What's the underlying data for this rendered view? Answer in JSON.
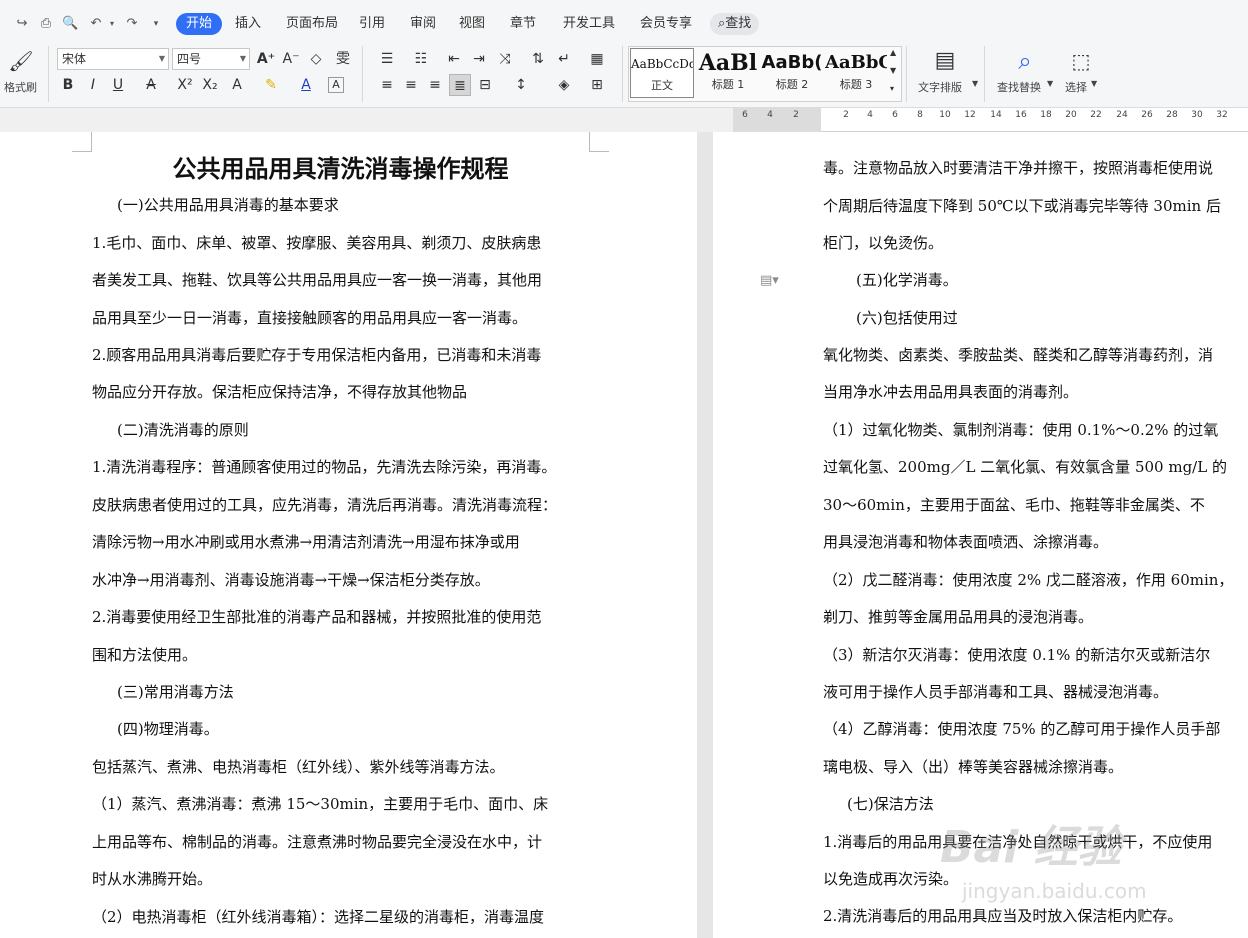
{
  "menubar": {
    "tabs": [
      "开始",
      "插入",
      "页面布局",
      "引用",
      "审阅",
      "视图",
      "章节",
      "开发工具",
      "会员专享"
    ],
    "active_tab": "开始",
    "search_label": "查找"
  },
  "ribbon": {
    "format_painter_label": "格式刷",
    "font_name": "宋体",
    "font_size": "四号",
    "styles": [
      {
        "sample": "AaBbCcDd",
        "name": "正文"
      },
      {
        "sample": "AaBl",
        "name": "标题 1"
      },
      {
        "sample": "AaBb(",
        "name": "标题 2"
      },
      {
        "sample": "AaBbC",
        "name": "标题 3"
      }
    ],
    "text_layout_label": "文字排版",
    "find_replace_label": "查找替换",
    "select_label": "选择",
    "accent_color": "#2f6ef5"
  },
  "ruler": {
    "ticks": [
      "6",
      "4",
      "2",
      "2",
      "4",
      "6",
      "8",
      "10",
      "12",
      "14",
      "16",
      "18",
      "20",
      "22",
      "24",
      "26",
      "28",
      "30",
      "32"
    ]
  },
  "page1": {
    "title": "公共用品用具清洗消毒操作规程",
    "lines": [
      "(一)公共用品用具消毒的基本要求",
      "1.毛巾、面巾、床单、被罩、按摩服、美容用具、剃须刀、皮肤病患",
      "者美发工具、拖鞋、饮具等公共用品用具应一客一换一消毒，其他用",
      "品用具至少一日一消毒，直接接触顾客的用品用具应一客一消毒。",
      "2.顾客用品用具消毒后要贮存于专用保洁柜内备用，已消毒和未消毒",
      "物品应分开存放。保洁柜应保持洁净，不得存放其他物品",
      "(二)清洗消毒的原则",
      "1.清洗消毒程序：普通顾客使用过的物品，先清洗去除污染，再消毒。",
      "皮肤病患者使用过的工具，应先消毒，清洗后再消毒。清洗消毒流程：",
      "清除污物→用水冲刷或用水煮沸→用清洁剂清洗→用湿布抹净或用",
      "水冲净→用消毒剂、消毒设施消毒→干燥→保洁柜分类存放。",
      "2.消毒要使用经卫生部批准的消毒产品和器械，并按照批准的使用范",
      "围和方法使用。",
      "(三)常用消毒方法",
      "(四)物理消毒。",
      "包括蒸汽、煮沸、电热消毒柜（红外线）、紫外线等消毒方法。",
      "（1）蒸汽、煮沸消毒：煮沸 15～30min，主要用于毛巾、面巾、床",
      "上用品等布、棉制品的消毒。注意煮沸时物品要完全浸没在水中，计",
      "时从水沸腾开始。",
      "（2）电热消毒柜（红外线消毒箱）：选择二星级的消毒柜，消毒温度"
    ]
  },
  "page2": {
    "lines": [
      "毒。注意物品放入时要清洁干净并擦干，按照消毒柜使用说",
      "个周期后待温度下降到 50℃以下或消毒完毕等待 30min 后",
      "柜门，以免烫伤。",
      "(五)化学消毒。",
      "(六)包括使用过",
      "氧化物类、卤素类、季胺盐类、醛类和乙醇等消毒药剂，消",
      "当用净水冲去用品用具表面的消毒剂。",
      "（1）过氧化物类、氯制剂消毒：使用 0.1%～0.2% 的过氧",
      "过氧化氢、200mg／L 二氧化氯、有效氯含量 500 mg/L 的",
      "30～60min，主要用于面盆、毛巾、拖鞋等非金属类、不",
      "用具浸泡消毒和物体表面喷洒、涂擦消毒。",
      "（2）戊二醛消毒：使用浓度 2% 戊二醛溶液，作用 60min，",
      "剃刀、推剪等金属用品用具的浸泡消毒。",
      "（3）新洁尔灭消毒：使用浓度 0.1% 的新洁尔灭或新洁尔",
      "液可用于操作人员手部消毒和工具、器械浸泡消毒。",
      "（4）乙醇消毒：使用浓度 75% 的乙醇可用于操作人员手部",
      "璃电极、导入（出）棒等美容器械涂擦消毒。",
      "(七)保洁方法",
      "1.消毒后的用品用具要在洁净处自然晾干或烘干，不应使用",
      "以免造成再次污染。",
      "2.清洗消毒后的用品用具应当及时放入保洁柜内贮存。"
    ]
  },
  "watermark": {
    "brand": "Bai 经验",
    "url": "jingyan.baidu.com"
  }
}
